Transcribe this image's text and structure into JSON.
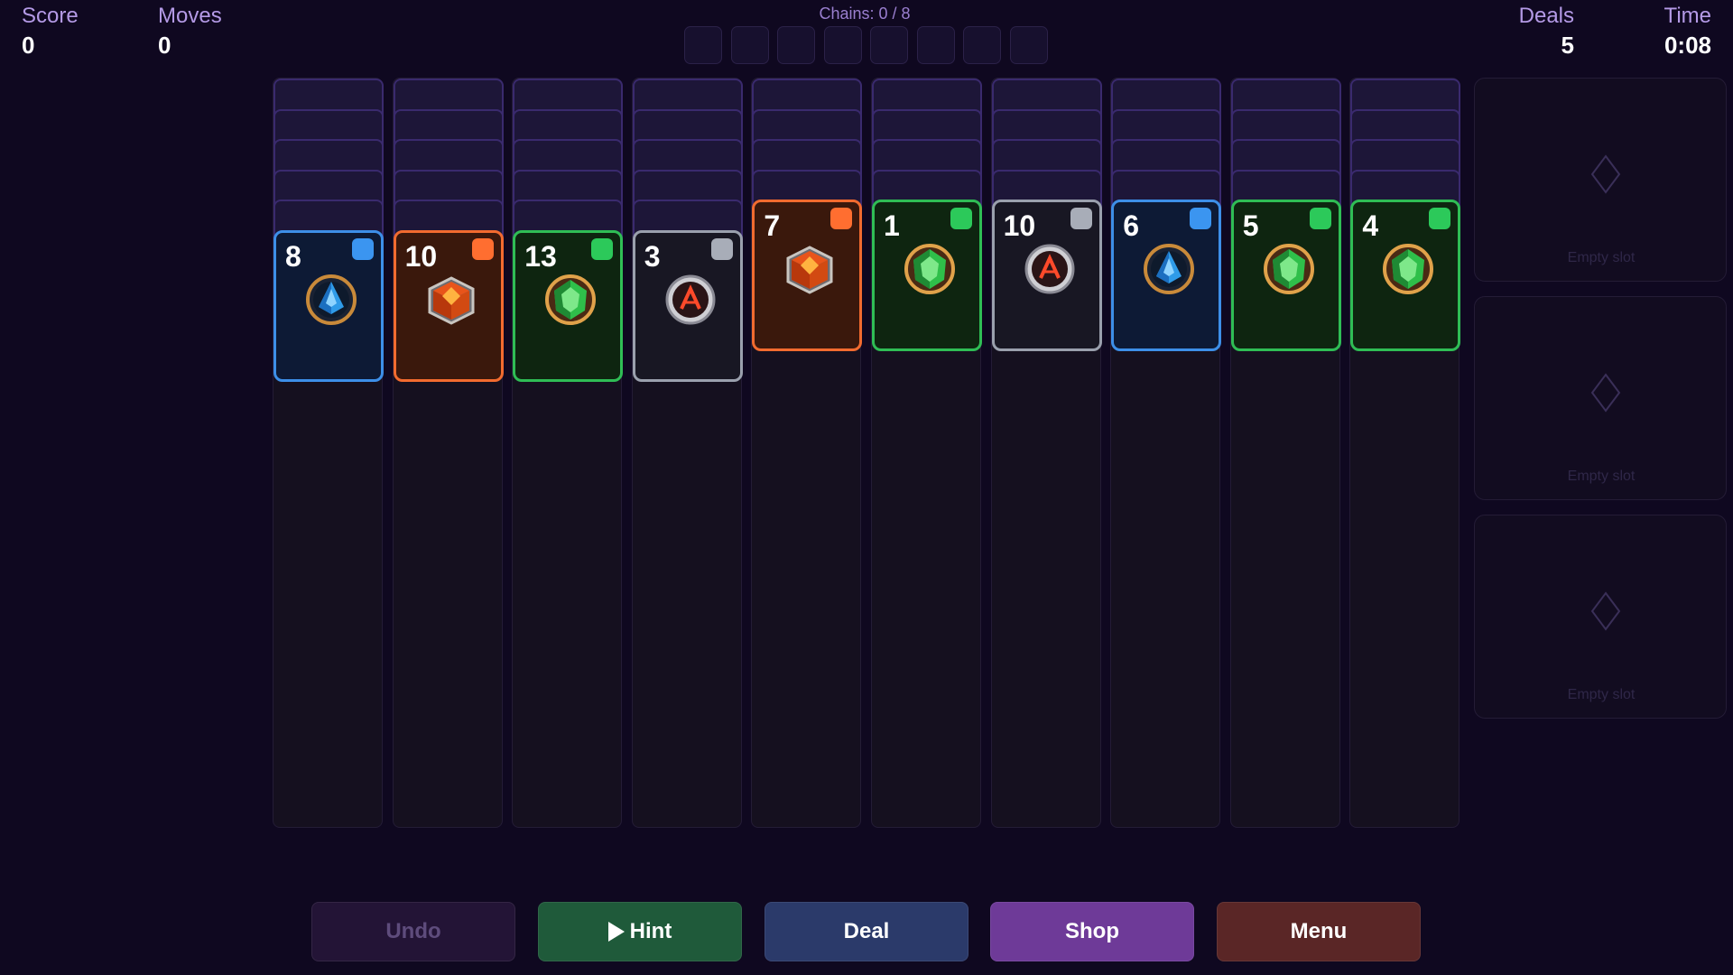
{
  "hud": {
    "score": {
      "label": "Score",
      "value": "0"
    },
    "moves": {
      "label": "Moves",
      "value": "0"
    },
    "deals": {
      "label": "Deals",
      "value": "5"
    },
    "time": {
      "label": "Time",
      "value": "0:08"
    }
  },
  "chains": {
    "label": "Chains: 0 / 8",
    "completed": 0,
    "total": 8
  },
  "columns": [
    {
      "facedown": 5,
      "card": {
        "rank": "8",
        "suit": "blue",
        "gem": "blue-crystal-gem-icon"
      }
    },
    {
      "facedown": 5,
      "card": {
        "rank": "10",
        "suit": "orange",
        "gem": "fire-cube-gem-icon"
      }
    },
    {
      "facedown": 5,
      "card": {
        "rank": "13",
        "suit": "green",
        "gem": "emerald-gem-icon"
      }
    },
    {
      "facedown": 5,
      "card": {
        "rank": "3",
        "suit": "gray",
        "gem": "obsidian-rune-gem-icon"
      }
    },
    {
      "facedown": 4,
      "card": {
        "rank": "7",
        "suit": "orange",
        "gem": "fire-cube-gem-icon"
      }
    },
    {
      "facedown": 4,
      "card": {
        "rank": "1",
        "suit": "green",
        "gem": "emerald-gem-icon"
      }
    },
    {
      "facedown": 4,
      "card": {
        "rank": "10",
        "suit": "gray",
        "gem": "obsidian-rune-gem-icon"
      }
    },
    {
      "facedown": 4,
      "card": {
        "rank": "6",
        "suit": "blue",
        "gem": "blue-crystal-gem-icon"
      }
    },
    {
      "facedown": 4,
      "card": {
        "rank": "5",
        "suit": "green",
        "gem": "emerald-gem-icon"
      }
    },
    {
      "facedown": 4,
      "card": {
        "rank": "4",
        "suit": "green",
        "gem": "emerald-gem-icon"
      }
    }
  ],
  "slots": [
    {
      "label": "Empty slot"
    },
    {
      "label": "Empty slot"
    },
    {
      "label": "Empty slot"
    }
  ],
  "buttons": {
    "undo": "Undo",
    "hint": "Hint",
    "deal": "Deal",
    "shop": "Shop",
    "menu": "Menu"
  },
  "colors": {
    "background": "#0f0820",
    "blue": "#3d8fe8",
    "orange": "#f26b2f",
    "green": "#2fbd55",
    "gray": "#9aa0ad"
  }
}
